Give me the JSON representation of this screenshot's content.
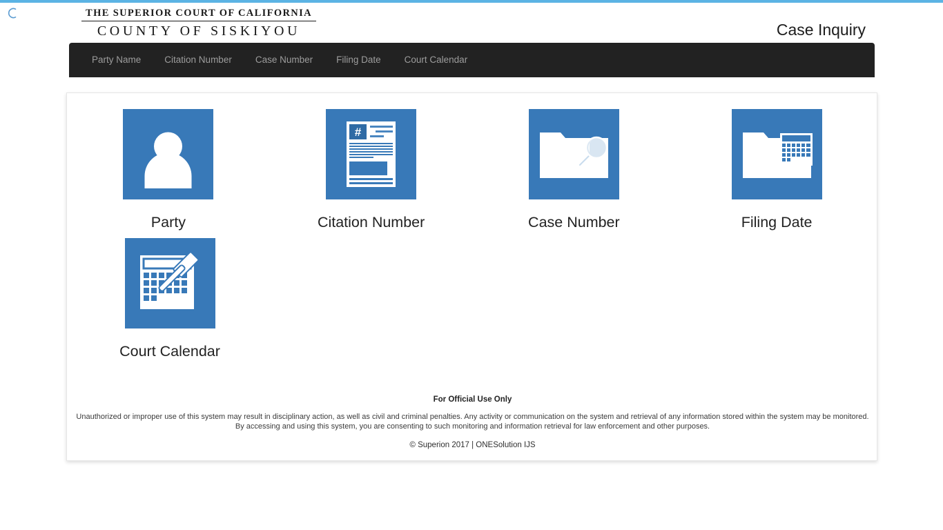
{
  "branding": {
    "logo_line1": "THE SUPERIOR COURT OF CALIFORNIA",
    "logo_line2": "COUNTY OF SISKIYOU",
    "spinner_icon": "loading-spinner-icon"
  },
  "header": {
    "app_title": "Case Inquiry"
  },
  "nav": {
    "items": [
      {
        "label": "Party Name",
        "name": "nav-party-name"
      },
      {
        "label": "Citation Number",
        "name": "nav-citation-number"
      },
      {
        "label": "Case Number",
        "name": "nav-case-number"
      },
      {
        "label": "Filing Date",
        "name": "nav-filing-date"
      },
      {
        "label": "Court Calendar",
        "name": "nav-court-calendar"
      }
    ]
  },
  "tiles": [
    {
      "label": "Party",
      "icon": "person-icon"
    },
    {
      "label": "Citation Number",
      "icon": "document-hash-icon"
    },
    {
      "label": "Case Number",
      "icon": "folder-magnifier-icon"
    },
    {
      "label": "Filing Date",
      "icon": "folder-calendar-icon"
    },
    {
      "label": "Court Calendar",
      "icon": "calendar-gavel-icon"
    }
  ],
  "footer": {
    "heading": "For Official Use Only",
    "disclaimer": "Unauthorized or improper use of this system may result in disciplinary action, as well as civil and criminal penalties. Any activity or communication on the system and retrieval of any information stored within the system may be monitored. By accessing and using this system, you are consenting to such monitoring and information retrieval for law enforcement and other purposes.",
    "copyright": "© Superion 2017 | ONESolution IJS"
  },
  "colors": {
    "accent_top_bar": "#5bb3e4",
    "tile_blue": "#3879b8",
    "navbar_dark": "#222222",
    "nav_text": "#9d9d9d"
  }
}
